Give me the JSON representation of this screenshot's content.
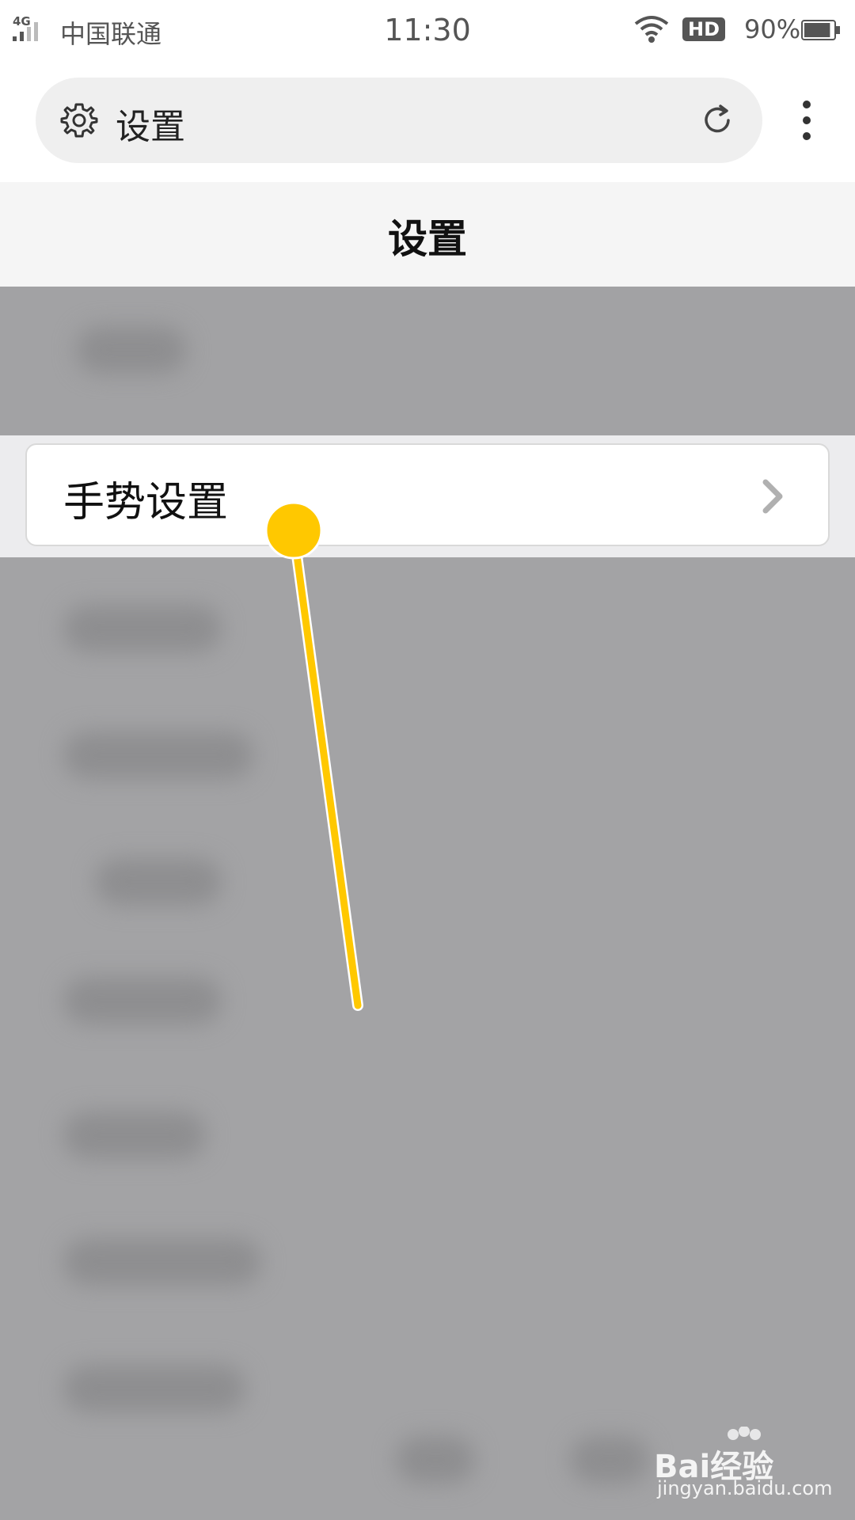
{
  "status_bar": {
    "network": "4G",
    "carrier": "中国联通",
    "time": "11:30",
    "hd_badge": "HD",
    "battery": "90%",
    "battery_level": 0.9
  },
  "url_bar": {
    "title": "设置",
    "icons": [
      "gear-icon",
      "reload-icon",
      "more-vert-icon"
    ]
  },
  "page": {
    "title": "设置"
  },
  "highlighted_item": {
    "label": "手势设置",
    "icon": "chevron-right-icon"
  },
  "watermark": {
    "brand": "Bai经验",
    "url": "jingyan.baidu.com"
  },
  "colors": {
    "pointer": "#ffc800",
    "overlay": "#a3a3a5",
    "chevron": "#b0b0b0"
  }
}
